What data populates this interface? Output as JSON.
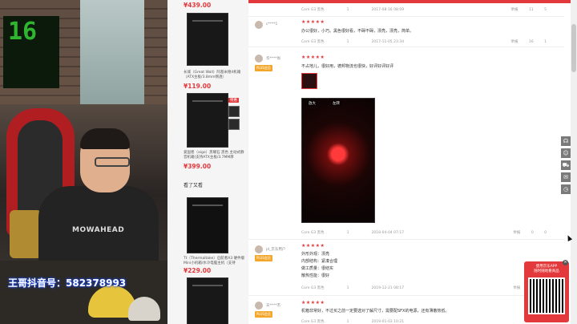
{
  "stream": {
    "watermark": "王哥抖音号：582378993",
    "shirt_text": "MOWAHEAD",
    "matrix_text": "16"
  },
  "sidebar": {
    "products": [
      {
        "price": "¥439.00"
      },
      {
        "name": "长城（Great Wall）阿基米德4机箱（ATX主板/3.8mm侧透）",
        "price": "¥119.00"
      },
      {
        "name": "爱国者（aigo）黑曜石 黑色 主动式静音机箱(支持ATX主板/3.7MM厚",
        "price": "¥399.00",
        "tag": "特惠"
      }
    ],
    "section_title": "看了又看",
    "products2": [
      {
        "name": "Tt（Thermaltake）启航者A3 硬件版 Mini小机箱/水冷电脑主机（支持",
        "price": "¥229.00"
      }
    ]
  },
  "reviews": [
    {
      "meta": [
        "Core G3 黑色",
        "1",
        "2017-08-16 08:09"
      ],
      "acts": [
        "举报",
        "11",
        "5"
      ]
    },
    {
      "user": "c****1",
      "stars": "★★★★★",
      "text": "办公很好，小巧。黑色很好看，不碍不碍，漂亮，漂亮，简单。",
      "meta": [
        "Core G3 黑色",
        "1",
        "2017-11-05 23:34"
      ],
      "acts": [
        "举报",
        "16",
        "1"
      ]
    },
    {
      "user": "华****尚",
      "badge": "PLUS会员",
      "stars": "★★★★★",
      "text": "不占地儿，很好用，德邦物流也很快，好评好评好评",
      "photo_labels": [
        "放大",
        "左转"
      ],
      "meta": [
        "Core G3 黑色",
        "1",
        "2018-04-04 07:17"
      ],
      "acts": [
        "举报",
        "0",
        "0"
      ]
    },
    {
      "user": "jd_京东用户",
      "badge": "PLUS会员",
      "stars": "★★★★★",
      "lines": [
        "外形外观：漂亮",
        "内部结构：紧凑合理",
        "做工质量：很结实",
        "散热性能：很好"
      ],
      "meta": [
        "Core G3 黑色",
        "1",
        "2019-12-21 08:17"
      ],
      "acts": [
        "举报",
        "0",
        "0"
      ]
    },
    {
      "user": "天****杰",
      "badge": "PLUS会员",
      "stars": "★★★★★",
      "text": "机箱非常好，不过买之前一定要选对了解尺寸，需要配SFX的电源，还有薄散热低。",
      "meta": [
        "Core G3 黑色",
        "1",
        "2019-01-03 10:21"
      ]
    }
  ],
  "float_icons": [
    "headset-icon",
    "user-icon",
    "cart-icon",
    "message-icon",
    "history-icon"
  ],
  "qr": {
    "title": "使用京东APP\n随时随地看商品",
    "close": "×"
  },
  "colors": {
    "accent": "#e4393c",
    "plus": "#f4a62a"
  }
}
